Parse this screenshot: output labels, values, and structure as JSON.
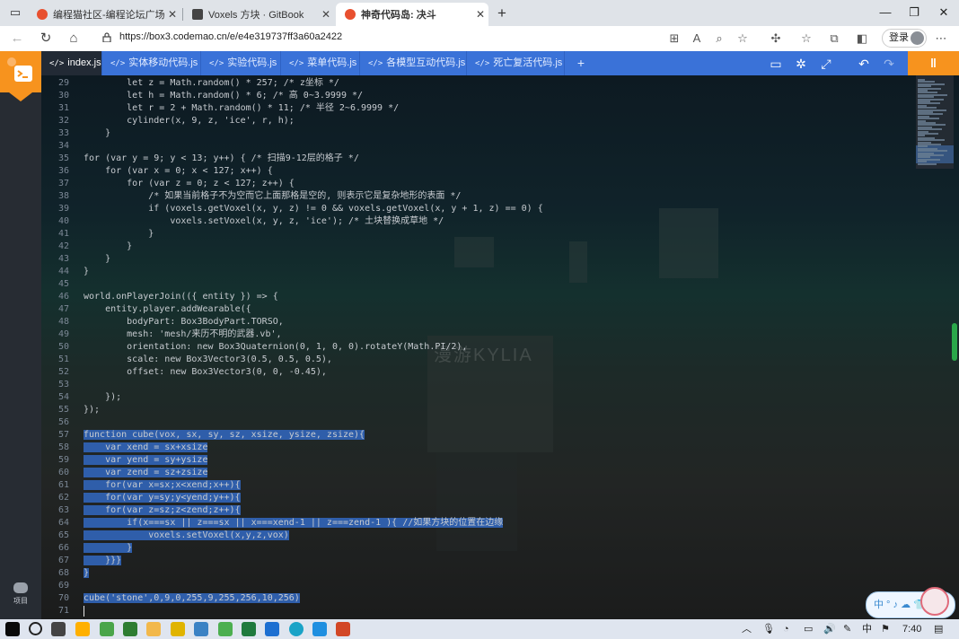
{
  "browser": {
    "tabs": [
      {
        "title": "编程猫社区-编程论坛广场-编程",
        "icon": "codemao-icon"
      },
      {
        "title": "Voxels 方块 · GitBook",
        "icon": "gitbook-icon"
      },
      {
        "title": "神奇代码岛: 决斗",
        "icon": "codemao-icon",
        "active": true
      }
    ],
    "new_tab": "+",
    "url": "https://box3.codemao.cn/e/e4e319737ff3a60a2422",
    "login_label": "登录"
  },
  "editor": {
    "tabs": [
      {
        "label": "index.js",
        "active": true
      },
      {
        "label": "实体移动代码.js"
      },
      {
        "label": "实验代码.js"
      },
      {
        "label": "菜单代码.js"
      },
      {
        "label": "各模型互动代码.js"
      },
      {
        "label": "死亡复活代码.js"
      }
    ],
    "add_tab": "+",
    "tab_prefix": "</>",
    "project_label": "项目",
    "watermark": "漫游KYLIA",
    "mascot_text": "中 ° ♪ ☁ 👕"
  },
  "code_lines": [
    {
      "n": "29",
      "text": "        let z = Math.random() * 257; /* z坐标 */"
    },
    {
      "n": "30",
      "text": "        let h = Math.random() * 6; /* 高 0~3.9999 */"
    },
    {
      "n": "31",
      "text": "        let r = 2 + Math.random() * 11; /* 半径 2~6.9999 */"
    },
    {
      "n": "32",
      "text": "        cylinder(x, 9, z, 'ice', r, h);"
    },
    {
      "n": "33",
      "text": "    }"
    },
    {
      "n": "34",
      "text": ""
    },
    {
      "n": "35",
      "text": "for (var y = 9; y < 13; y++) { /* 扫描9-12层的格子 */"
    },
    {
      "n": "36",
      "text": "    for (var x = 0; x < 127; x++) {"
    },
    {
      "n": "37",
      "text": "        for (var z = 0; z < 127; z++) {"
    },
    {
      "n": "38",
      "text": "            /* 如果当前格子不为空而它上面那格是空的, 则表示它是复杂地形的表面 */"
    },
    {
      "n": "39",
      "text": "            if (voxels.getVoxel(x, y, z) != 0 && voxels.getVoxel(x, y + 1, z) == 0) {"
    },
    {
      "n": "40",
      "text": "                voxels.setVoxel(x, y, z, 'ice'); /* 土块替换成草地 */"
    },
    {
      "n": "41",
      "text": "            }"
    },
    {
      "n": "42",
      "text": "        }"
    },
    {
      "n": "43",
      "text": "    }"
    },
    {
      "n": "44",
      "text": "}"
    },
    {
      "n": "45",
      "text": ""
    },
    {
      "n": "46",
      "text": "world.onPlayerJoin(({ entity }) => {"
    },
    {
      "n": "47",
      "text": "    entity.player.addWearable({"
    },
    {
      "n": "48",
      "text": "        bodyPart: Box3BodyPart.TORSO,"
    },
    {
      "n": "49",
      "text": "        mesh: 'mesh/来历不明的武器.vb',"
    },
    {
      "n": "50",
      "text": "        orientation: new Box3Quaternion(0, 1, 0, 0).rotateY(Math.PI/2),"
    },
    {
      "n": "51",
      "text": "        scale: new Box3Vector3(0.5, 0.5, 0.5),"
    },
    {
      "n": "52",
      "text": "        offset: new Box3Vector3(0, 0, -0.45),"
    },
    {
      "n": "53",
      "text": ""
    },
    {
      "n": "54",
      "text": "    });"
    },
    {
      "n": "55",
      "text": "});"
    },
    {
      "n": "56",
      "text": ""
    },
    {
      "n": "57",
      "text": "function cube(vox, sx, sy, sz, xsize, ysize, zsize){",
      "sel": true
    },
    {
      "n": "58",
      "text": "    var xend = sx+xsize",
      "sel": true
    },
    {
      "n": "59",
      "text": "    var yend = sy+ysize",
      "sel": true
    },
    {
      "n": "60",
      "text": "    var zend = sz+zsize",
      "sel": true
    },
    {
      "n": "61",
      "text": "    for(var x=sx;x<xend;x++){",
      "sel": true
    },
    {
      "n": "62",
      "text": "    for(var y=sy;y<yend;y++){",
      "sel": true
    },
    {
      "n": "63",
      "text": "    for(var z=sz;z<zend;z++){",
      "sel": true
    },
    {
      "n": "64",
      "text": "        if(x===sx || z===sx || x===xend-1 || z===zend-1 ){ //如果方块的位置在边缘",
      "sel": true
    },
    {
      "n": "65",
      "text": "            voxels.setVoxel(x,y,z,vox)",
      "sel": true
    },
    {
      "n": "66",
      "text": "        }",
      "sel": true
    },
    {
      "n": "67",
      "text": "    }}}",
      "sel": true
    },
    {
      "n": "68",
      "text": "}",
      "sel": true
    },
    {
      "n": "69",
      "text": ""
    },
    {
      "n": "70",
      "text": "cube('stone',0,9,0,255,9,255,256,10,256)",
      "sel": true
    },
    {
      "n": "71",
      "text": ""
    }
  ],
  "taskbar": {
    "time": "7:40"
  },
  "colors": {
    "editor_tab_bar": "#3a72d8",
    "accent_orange": "#f7931e",
    "selection": "#2f5eaa",
    "keyword": "#4d8fe8",
    "comment": "#6f8a63",
    "string": "#d09070"
  }
}
